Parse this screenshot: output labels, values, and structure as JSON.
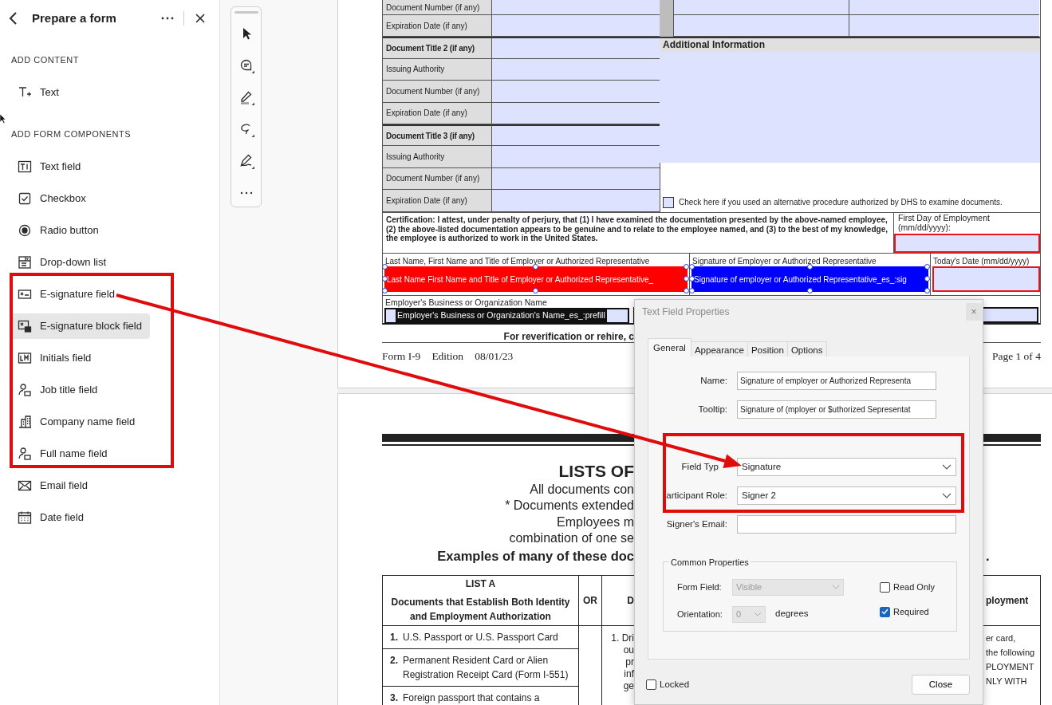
{
  "panel": {
    "title": "Prepare a form",
    "sections": [
      {
        "heading": "ADD CONTENT",
        "items": [
          {
            "label": "Text",
            "selected": false
          }
        ]
      },
      {
        "heading": "ADD FORM COMPONENTS",
        "items": [
          {
            "label": "Text field",
            "selected": false
          },
          {
            "label": "Checkbox",
            "selected": false
          },
          {
            "label": "Radio button",
            "selected": false
          },
          {
            "label": "Drop-down list",
            "selected": false
          },
          {
            "label": "E-signature field",
            "selected": false
          },
          {
            "label": "E-signature block field",
            "selected": true
          },
          {
            "label": "Initials field",
            "selected": false
          },
          {
            "label": "Job title field",
            "selected": false
          },
          {
            "label": "Company name field",
            "selected": false
          },
          {
            "label": "Full name field",
            "selected": false
          },
          {
            "label": "Email field",
            "selected": false
          },
          {
            "label": "Date field",
            "selected": false
          }
        ]
      }
    ]
  },
  "document": {
    "page1": {
      "id_rows": [
        {
          "label": "Document Number (if any)",
          "kind": "field"
        },
        {
          "label": "Expiration Date (if any)",
          "kind": "field"
        },
        {
          "label": "Document Title 2 (if any)",
          "kind": "heading"
        },
        {
          "label": "Issuing Authority",
          "kind": "field"
        },
        {
          "label": "Document Number (if any)",
          "kind": "field"
        },
        {
          "label": "Expiration Date (if any)",
          "kind": "field"
        },
        {
          "label": "Document Title 3 (if any)",
          "kind": "heading"
        },
        {
          "label": "Issuing Authority",
          "kind": "field"
        },
        {
          "label": "Document Number (if any)",
          "kind": "field"
        },
        {
          "label": "Expiration Date (if any)",
          "kind": "field"
        }
      ],
      "additional_info": "Additional Information",
      "alt_procedure": {
        "label": "Check here if you used an alternative procedure authorized by DHS to examine documents.",
        "checked": false
      },
      "certification": "Certification:  I attest, under penalty of perjury, that (1) I have examined the documentation presented by the above-named employee, (2) the above-listed documentation appears to be genuine and to relate to the employee named, and (3) to the best of my knowledge, the employee is authorized to work in the United States.",
      "first_day_label": "First Day of Employment (mm/dd/yyyy):",
      "signature_columns": [
        {
          "label": "Last Name, First Name and Title of Employer or Authorized Representative",
          "field_text": "Last Name First Name and Title of Employer or Authorized Representative_",
          "color": "#ff0000",
          "filled": true
        },
        {
          "label": "Signature of Employer or Authorized Representative",
          "field_text": "Signature of employer or Authorized Representative_es_:sig",
          "color": "#0000ff",
          "filled": true
        },
        {
          "label": "Today's Date (mm/dd/yyyy)",
          "color": "#e8141b",
          "filled": false
        }
      ],
      "employer_label": "Employer's Business or Organization Name",
      "employer_field": "Employer's Business or Organization's Name_es_:prefill",
      "reverification": "For reverification or rehire, c",
      "footer": [
        "Form I-9",
        "Edition",
        "08/01/23"
      ],
      "page_number": "Page 1 of 4"
    },
    "page2": {
      "title": "LISTS OF",
      "intro": [
        "All documents con",
        "* Documents extended",
        "Employees m",
        "combination of one se"
      ],
      "examples": "Examples of many of these doc",
      "examples_end": ".",
      "table": {
        "list_a_heading": "LIST A",
        "list_a_subheading": "Documents that Establish Both Identity and Employment Authorization",
        "or": "OR",
        "column_3_heading": "D",
        "column_4_heading": "ployment",
        "list_a": [
          {
            "number": "1.",
            "text": "U.S. Passport or U.S. Passport Card"
          },
          {
            "number": "2.",
            "text": "Permanent Resident Card or Alien Registration Receipt Card (Form I-551)"
          },
          {
            "number": "3.",
            "text": "Foreign passport that contains a"
          }
        ],
        "column_3_lines": [
          "1. Dri",
          "ou",
          "pr",
          "inf",
          "ge"
        ],
        "column_4_lines": [
          "er card,",
          "the following",
          "PLOYMENT",
          "NLY WITH"
        ]
      }
    }
  },
  "dialog": {
    "title": "Text Field Properties",
    "close": "×",
    "tabs": [
      {
        "label": "General",
        "selected": true
      },
      {
        "label": "Appearance",
        "selected": false
      },
      {
        "label": "Position",
        "selected": false
      },
      {
        "label": "Options",
        "selected": false
      }
    ],
    "fields": [
      {
        "label": "Name:",
        "value": "Signature of employer or Authorized Representa",
        "kind": "text"
      },
      {
        "label": "Tooltip:",
        "value": "Signature of (mployer or $uthorized Sepresentat",
        "kind": "text"
      },
      {
        "label": "Field Typ",
        "value": "Signature",
        "kind": "select"
      },
      {
        "label": "articipant Role:",
        "value": "Signer 2",
        "kind": "select"
      },
      {
        "label": "Signer's Email:",
        "kind": "text"
      }
    ],
    "common": {
      "legend": "Common Properties",
      "form_field": {
        "label": "Form Field:",
        "value": "Visible",
        "disabled": true
      },
      "orientation": {
        "label": "Orientation:",
        "value": "0",
        "unit": "degrees",
        "disabled": true
      },
      "checkboxes": [
        {
          "label": "Read Only",
          "checked": false
        },
        {
          "label": "Required",
          "checked": true
        }
      ]
    },
    "locked": {
      "label": "Locked",
      "checked": false
    },
    "close_button": "Close"
  }
}
